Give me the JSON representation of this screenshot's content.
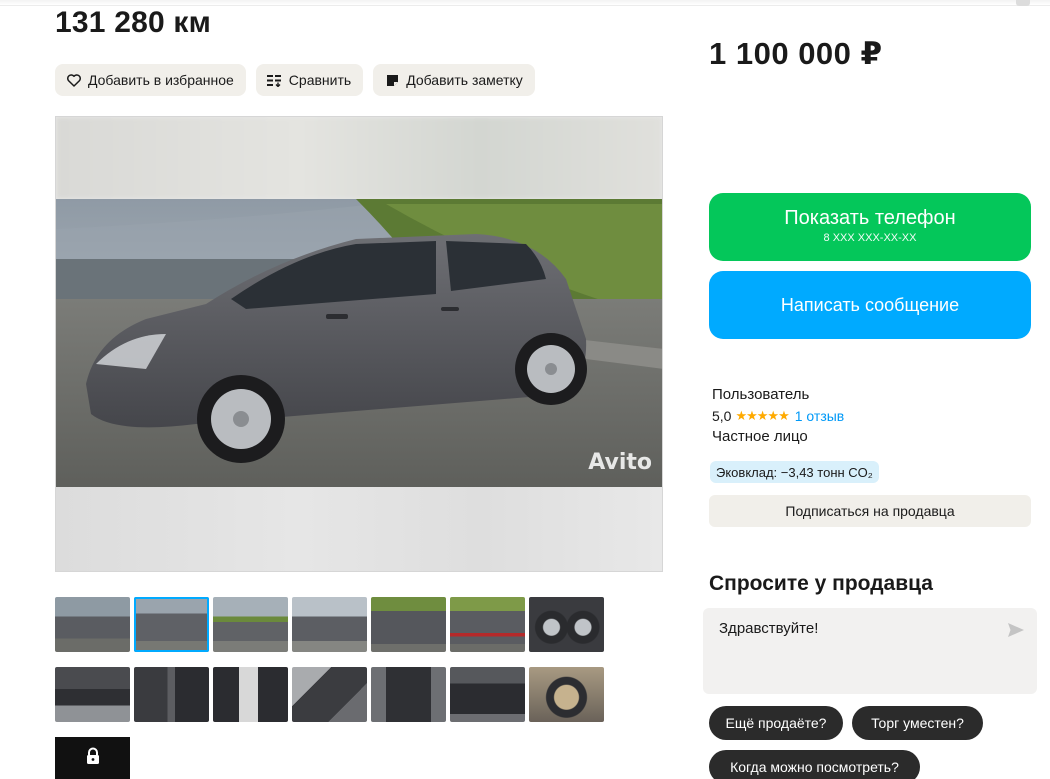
{
  "listing": {
    "mileage": "131 280 км",
    "price": "1 100 000 ₽"
  },
  "actions": {
    "favorite_label": "Добавить в избранное",
    "compare_label": "Сравнить",
    "note_label": "Добавить заметку"
  },
  "gallery": {
    "watermark": "Avito",
    "thumbnail_count": 14,
    "active_thumbnail": 2
  },
  "contact": {
    "phone_label": "Показать телефон",
    "phone_masked": "8 XXX XXX-XX-XX",
    "message_label": "Написать сообщение"
  },
  "seller": {
    "name": "Пользователь",
    "rating": "5,0",
    "stars": "★★★★★",
    "reviews": "1 отзыв",
    "type": "Частное лицо",
    "eco": "Эковклад: −3,43 тонн CO₂",
    "subscribe_label": "Подписаться на продавца"
  },
  "ask": {
    "title": "Спросите у продавца",
    "message": "Здравствуйте!",
    "chips": [
      "Ещё продаёте?",
      "Торг уместен?",
      "Когда можно посмотреть?"
    ]
  },
  "colors": {
    "accent_green": "#04c75a",
    "accent_blue": "#00aaff",
    "star": "#ffaa00",
    "link": "#0099f7"
  },
  "icons": [
    "heart-icon",
    "compare-icon",
    "note-icon",
    "lock-icon",
    "send-icon"
  ]
}
